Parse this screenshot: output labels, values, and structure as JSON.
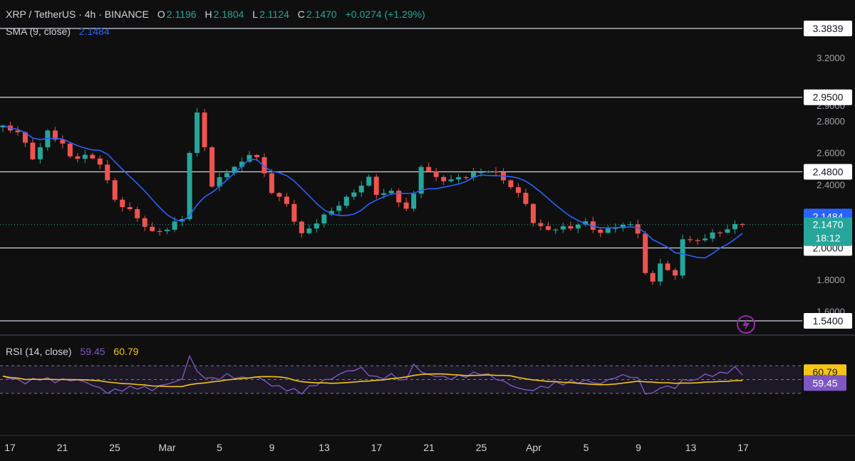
{
  "header": {
    "symbol": "XRP / TetherUS · 4h · BINANCE",
    "o_label": "O",
    "o_value": "2.1196",
    "h_label": "H",
    "h_value": "2.1804",
    "l_label": "L",
    "l_value": "2.1124",
    "c_label": "C",
    "c_value": "2.1470",
    "change": "+0.0274 (+1.29%)",
    "sma_label": "SMA (9, close)",
    "sma_value": "2.1484"
  },
  "rsi_header": {
    "label": "RSI (14, close)",
    "value": "59.45",
    "ma_value": "60.79"
  },
  "colors": {
    "background": "#0f0f0f",
    "up": "#26a69a",
    "down": "#ef5350",
    "sma": "#2962ff",
    "rsi": "#7e57c2",
    "rsi_ma": "#f5c518",
    "hline": "#d1d4dc",
    "text": "#d1d4dc",
    "countdown_bg": "#26a69a"
  },
  "icon": "lightning-icon",
  "chart_data": {
    "type": "candlestick",
    "y_ticks": [
      "3.2000",
      "2.8000",
      "2.6000",
      "2.4000",
      "1.8000",
      "1.6000",
      "2.9000"
    ],
    "y_range": [
      1.54,
      3.3839
    ],
    "horizontal_lines": [
      "3.3839",
      "2.9500",
      "2.4800",
      "2.0000",
      "1.5400"
    ],
    "price_labels": {
      "sma": "2.1484",
      "last": "2.1470",
      "countdown": "18:12"
    },
    "x_ticks": [
      "17",
      "21",
      "25",
      "Mar",
      "5",
      "9",
      "13",
      "17",
      "21",
      "25",
      "Apr",
      "5",
      "9",
      "13",
      "17"
    ],
    "price_path": [
      [
        0,
        2.76
      ],
      [
        2,
        2.72
      ],
      [
        4,
        2.55
      ],
      [
        5,
        2.62
      ],
      [
        6,
        2.72
      ],
      [
        8,
        2.66
      ],
      [
        9,
        2.58
      ],
      [
        11,
        2.6
      ],
      [
        13,
        2.55
      ],
      [
        15,
        2.3
      ],
      [
        17,
        2.22
      ],
      [
        18,
        2.17
      ],
      [
        20,
        2.08
      ],
      [
        22,
        2.12
      ],
      [
        24,
        2.2
      ],
      [
        25,
        2.62
      ],
      [
        26,
        2.86
      ],
      [
        27,
        2.66
      ],
      [
        28,
        2.4
      ],
      [
        30,
        2.48
      ],
      [
        32,
        2.52
      ],
      [
        33,
        2.58
      ],
      [
        34,
        2.55
      ],
      [
        36,
        2.35
      ],
      [
        38,
        2.28
      ],
      [
        40,
        2.1
      ],
      [
        42,
        2.18
      ],
      [
        44,
        2.24
      ],
      [
        46,
        2.3
      ],
      [
        48,
        2.38
      ],
      [
        49,
        2.42
      ],
      [
        50,
        2.33
      ],
      [
        52,
        2.35
      ],
      [
        54,
        2.26
      ],
      [
        55,
        2.35
      ],
      [
        56,
        2.54
      ],
      [
        58,
        2.45
      ],
      [
        60,
        2.42
      ],
      [
        62,
        2.44
      ],
      [
        64,
        2.46
      ],
      [
        65,
        2.48
      ],
      [
        66,
        2.46
      ],
      [
        68,
        2.4
      ],
      [
        70,
        2.3
      ],
      [
        71,
        2.18
      ],
      [
        72,
        2.14
      ],
      [
        74,
        2.12
      ],
      [
        76,
        2.12
      ],
      [
        78,
        2.14
      ],
      [
        80,
        2.08
      ],
      [
        82,
        2.14
      ],
      [
        84,
        2.16
      ],
      [
        85,
        2.12
      ],
      [
        86,
        1.85
      ],
      [
        87,
        1.8
      ],
      [
        88,
        1.92
      ],
      [
        89,
        1.85
      ],
      [
        90,
        1.82
      ],
      [
        91,
        2.05
      ],
      [
        92,
        2.02
      ],
      [
        94,
        2.05
      ],
      [
        96,
        2.1
      ],
      [
        98,
        2.15
      ],
      [
        99,
        2.147
      ]
    ],
    "sma": {
      "name": "SMA (9, close)",
      "last": 2.1484
    },
    "rsi": {
      "name": "RSI (14, close)",
      "last": 59.45,
      "ma_last": 60.79,
      "levels": [
        70,
        50,
        30
      ],
      "tick": "40.00",
      "path": [
        [
          0,
          55
        ],
        [
          3,
          46
        ],
        [
          5,
          52
        ],
        [
          7,
          48
        ],
        [
          9,
          50
        ],
        [
          11,
          47
        ],
        [
          14,
          32
        ],
        [
          16,
          36
        ],
        [
          18,
          39
        ],
        [
          20,
          36
        ],
        [
          22,
          44
        ],
        [
          24,
          50
        ],
        [
          25,
          86
        ],
        [
          26,
          60
        ],
        [
          28,
          50
        ],
        [
          30,
          56
        ],
        [
          32,
          52
        ],
        [
          34,
          54
        ],
        [
          36,
          42
        ],
        [
          38,
          36
        ],
        [
          40,
          32
        ],
        [
          42,
          44
        ],
        [
          44,
          52
        ],
        [
          46,
          62
        ],
        [
          48,
          66
        ],
        [
          49,
          58
        ],
        [
          50,
          52
        ],
        [
          52,
          56
        ],
        [
          54,
          48
        ],
        [
          55,
          74
        ],
        [
          56,
          60
        ],
        [
          58,
          55
        ],
        [
          60,
          52
        ],
        [
          62,
          56
        ],
        [
          64,
          60
        ],
        [
          65,
          56
        ],
        [
          66,
          52
        ],
        [
          68,
          42
        ],
        [
          70,
          34
        ],
        [
          72,
          38
        ],
        [
          74,
          44
        ],
        [
          76,
          46
        ],
        [
          78,
          48
        ],
        [
          80,
          44
        ],
        [
          82,
          54
        ],
        [
          84,
          56
        ],
        [
          85,
          50
        ],
        [
          86,
          32
        ],
        [
          87,
          28
        ],
        [
          88,
          40
        ],
        [
          90,
          38
        ],
        [
          91,
          50
        ],
        [
          92,
          48
        ],
        [
          94,
          56
        ],
        [
          96,
          58
        ],
        [
          98,
          66
        ],
        [
          99,
          59
        ]
      ]
    }
  }
}
